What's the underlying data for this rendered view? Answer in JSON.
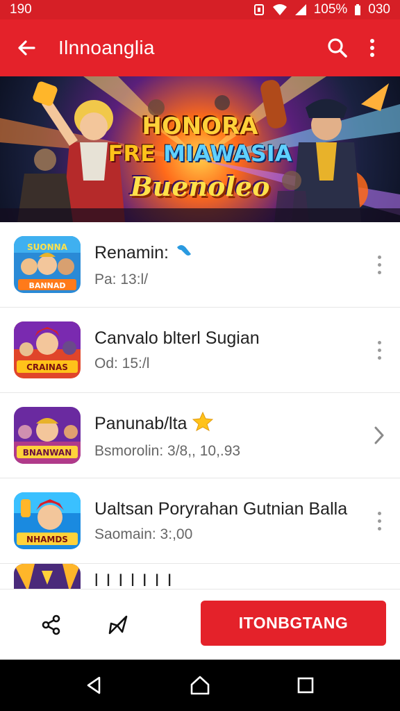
{
  "status_bar": {
    "time": "190",
    "battery_percent": "105%",
    "clock_right": "030",
    "icons": [
      "alarm-icon",
      "wifi-icon",
      "signal-icon",
      "battery-icon"
    ]
  },
  "app_bar": {
    "title": "Ilnnoanglia",
    "icons": [
      "back-arrow-icon",
      "search-icon",
      "more-vert-icon"
    ]
  },
  "banner": {
    "line1": "HONORA",
    "line2_a": "FRE ",
    "line2_b": "MIAWASIA",
    "line3": "Buenoleo"
  },
  "list": {
    "items": [
      {
        "title": "Renamin:",
        "subtitle": "Pa: 13:l/",
        "badge": "blue-dot-icon",
        "action": "more-vert-icon",
        "thumb_text": "SUONNA",
        "thumb_text2": "BANNAD"
      },
      {
        "title": "Canvalo blterl Sugian",
        "subtitle": "Od: 15:/l",
        "badge": "",
        "action": "more-vert-icon",
        "thumb_text": "CRAINAS",
        "thumb_text2": ""
      },
      {
        "title": "Panunab/lta",
        "subtitle": "Bsmorolin: 3/8,, 10,.93",
        "badge": "star-icon",
        "action": "chevron-right-icon",
        "thumb_text": "BNANWAN",
        "thumb_text2": ""
      },
      {
        "title": "Ualtsan Poryrahan Gutnian Balla",
        "subtitle": "Saomain: 3:,00",
        "badge": "",
        "action": "more-vert-icon",
        "thumb_text": "NHAMDS",
        "thumb_text2": ""
      },
      {
        "title": "l I I  l  I  I  I",
        "subtitle": "",
        "badge": "",
        "action": "",
        "thumb_text": "",
        "thumb_text2": ""
      }
    ]
  },
  "action_bar": {
    "primary_label": "ITONBGTANG",
    "icons": [
      "share-icon",
      "send-icon"
    ]
  },
  "nav_bar": {
    "icons": [
      "back-triangle-icon",
      "home-icon",
      "recents-icon"
    ]
  },
  "colors": {
    "brand_red": "#e4222a",
    "status_red": "#d61f26"
  }
}
